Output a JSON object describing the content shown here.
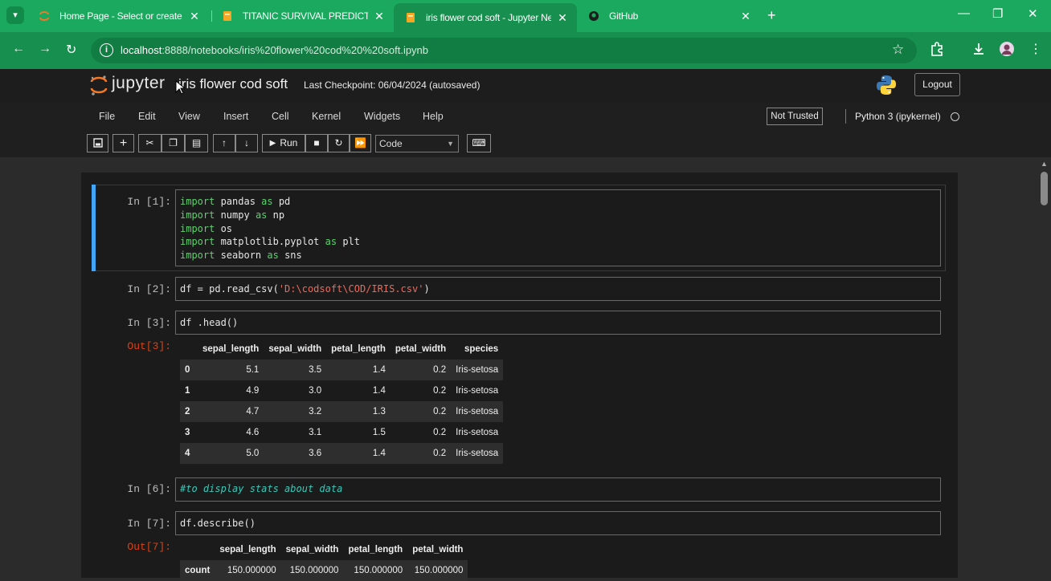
{
  "browser": {
    "tabs": [
      {
        "title": "Home Page - Select or create a",
        "icon": "jupyter-orange-icon"
      },
      {
        "title": "TITANIC SURVIVAL PREDICTION",
        "icon": "notebook-icon"
      },
      {
        "title": "iris flower cod soft - Jupyter Ne",
        "icon": "notebook-icon",
        "active": true
      },
      {
        "title": "GitHub",
        "icon": "github-icon"
      }
    ],
    "url_host": "localhost",
    "url_path": ":8888/notebooks/iris%20flower%20cod%20%20soft.ipynb"
  },
  "jupyter": {
    "wordmark": "jupyter",
    "notebook_name": "iris flower cod soft",
    "checkpoint": "Last Checkpoint: 06/04/2024  (autosaved)",
    "logout": "Logout",
    "menu": [
      "File",
      "Edit",
      "View",
      "Insert",
      "Cell",
      "Kernel",
      "Widgets",
      "Help"
    ],
    "trust": "Not Trusted",
    "kernel": "Python 3 (ipykernel)",
    "run_label": "Run",
    "cell_type": "Code"
  },
  "cells": {
    "c1": {
      "prompt": "In [1]:"
    },
    "c2": {
      "prompt": "In [2]:"
    },
    "c3": {
      "prompt": "In [3]:",
      "out_prompt": "Out[3]:"
    },
    "c6": {
      "prompt": "In [6]:"
    },
    "c7": {
      "prompt": "In [7]:",
      "out_prompt": "Out[7]:"
    }
  },
  "head_table": {
    "columns": [
      "sepal_length",
      "sepal_width",
      "petal_length",
      "petal_width",
      "species"
    ],
    "rows": [
      [
        "0",
        "5.1",
        "3.5",
        "1.4",
        "0.2",
        "Iris-setosa"
      ],
      [
        "1",
        "4.9",
        "3.0",
        "1.4",
        "0.2",
        "Iris-setosa"
      ],
      [
        "2",
        "4.7",
        "3.2",
        "1.3",
        "0.2",
        "Iris-setosa"
      ],
      [
        "3",
        "4.6",
        "3.1",
        "1.5",
        "0.2",
        "Iris-setosa"
      ],
      [
        "4",
        "5.0",
        "3.6",
        "1.4",
        "0.2",
        "Iris-setosa"
      ]
    ]
  },
  "describe_table": {
    "columns": [
      "sepal_length",
      "sepal_width",
      "petal_length",
      "petal_width"
    ],
    "rows": [
      [
        "count",
        "150.000000",
        "150.000000",
        "150.000000",
        "150.000000"
      ]
    ]
  },
  "colors": {
    "chrome_green": "#1aa95e",
    "selection_blue": "#42a5f5",
    "keyword_green": "#59d36c",
    "string_red": "#f0695b",
    "comment_teal": "#38c8b8",
    "out_prompt": "#d84315"
  }
}
